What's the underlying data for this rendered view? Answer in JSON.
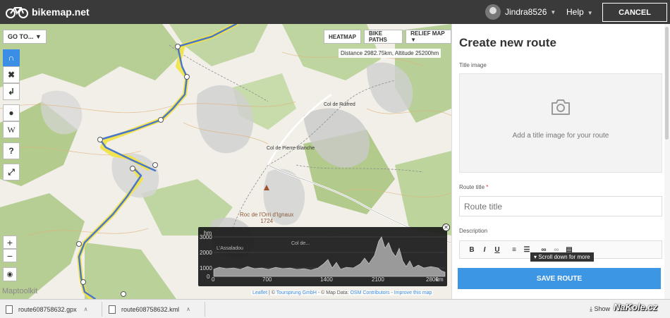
{
  "header": {
    "logo_text": "bikemap.net",
    "username": "Jindra8526",
    "help_label": "Help",
    "cancel_label": "CANCEL"
  },
  "map": {
    "goto_label": "GO TO... ▼",
    "layer_buttons": [
      "HEATMAP",
      "BIKE PATHS",
      "RELIEF MAP ▼"
    ],
    "distance_readout": "Distance 2982.75km, Altitude 25200hm",
    "place_labels": {
      "col_ruifred": "Col de Ruifred",
      "col_pierre_blanche": "Col de Pierre Blanche",
      "peak_name": "Roc de l'Orri d'Ignaux",
      "peak_elev": "1724"
    },
    "maptoolkit_logo": "Maptoolkit",
    "attribution": {
      "leaflet": "Leaflet",
      "sep1": " | © ",
      "tourenplaner": "Toursprung GmbH",
      "sep2": " - © Map Data: ",
      "osm": "OSM Contributors",
      "sep3": " - ",
      "improve": "Improve this map"
    },
    "zoom_in": "+",
    "zoom_out": "−"
  },
  "elevation": {
    "unit": "hm",
    "yticks": [
      "3000",
      "2000",
      "1000",
      "0"
    ],
    "xticks": [
      "0",
      "700",
      "1400",
      "2100",
      "2800"
    ],
    "x_unit": "km",
    "labels": [
      "L'Assaladou",
      "Col de..."
    ]
  },
  "sidebar": {
    "heading": "Create new route",
    "title_image_label": "Title image",
    "title_image_hint": "Add a title image for your route",
    "route_title_label": "Route title",
    "required_mark": "*",
    "route_title_placeholder": "Route title",
    "description_label": "Description",
    "editor_buttons": [
      "B",
      "I",
      "U"
    ],
    "scroll_hint": "▾ Scroll down for more",
    "save_label": "SAVE ROUTE"
  },
  "downloads": {
    "items": [
      "route608758632.gpx",
      "route608758632.kml"
    ],
    "show_all_label": "Show"
  },
  "watermark": "NaKole.cz",
  "colors": {
    "header_bg": "#3a3a3a",
    "accent": "#3d96e4",
    "route_line": "#4b77c9",
    "route_highlight": "#f2e34a"
  }
}
